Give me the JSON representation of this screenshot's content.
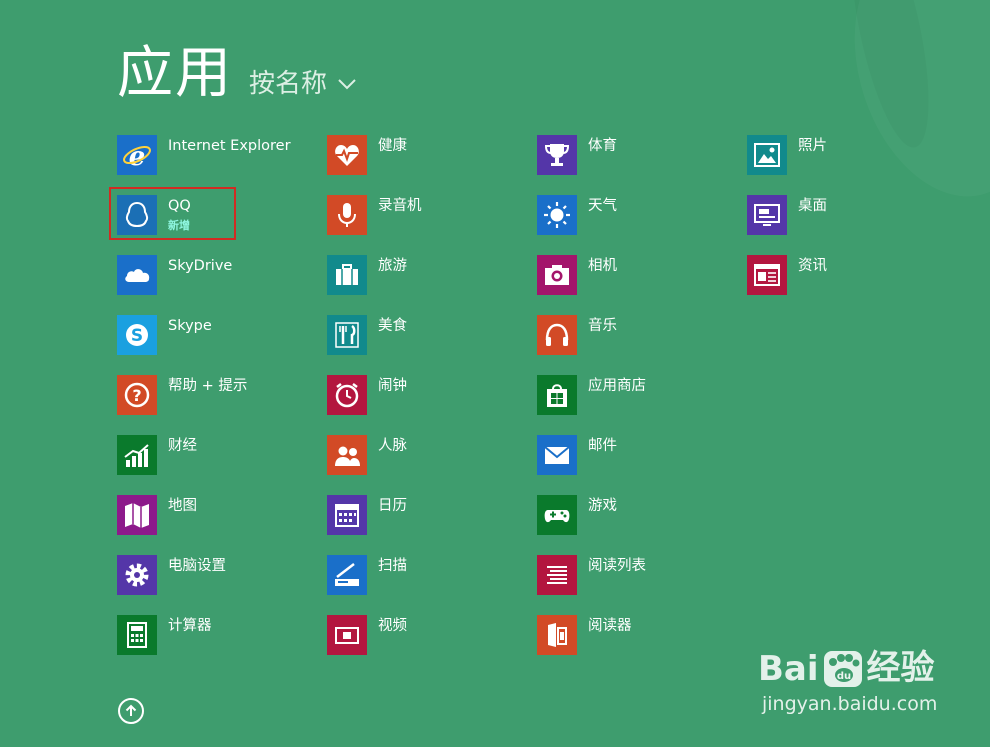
{
  "header": {
    "title": "应用",
    "sort_label": "按名称",
    "sort_icon": "chevron-down-icon"
  },
  "columns": [
    {
      "apps": [
        {
          "name": "Internet Explorer",
          "icon": "internet-explorer-icon",
          "color": "#1a6fc9"
        },
        {
          "name": "QQ",
          "icon": "qq-penguin-icon",
          "color": "#1b6fb5",
          "badge": "新增",
          "selected": true
        },
        {
          "name": "SkyDrive",
          "icon": "cloud-icon",
          "color": "#1a6fc9"
        },
        {
          "name": "Skype",
          "icon": "skype-icon",
          "color": "#1aa0e0"
        },
        {
          "name": "帮助 + 提示",
          "icon": "question-icon",
          "color": "#d24a26"
        },
        {
          "name": "财经",
          "icon": "finance-chart-icon",
          "color": "#0a7a2c"
        },
        {
          "name": "地图",
          "icon": "map-icon",
          "color": "#8d1a8b"
        },
        {
          "name": "电脑设置",
          "icon": "gear-icon",
          "color": "#5436a8"
        },
        {
          "name": "计算器",
          "icon": "calculator-icon",
          "color": "#0a7a2c"
        }
      ]
    },
    {
      "apps": [
        {
          "name": "健康",
          "icon": "heart-pulse-icon",
          "color": "#d24a26"
        },
        {
          "name": "录音机",
          "icon": "microphone-icon",
          "color": "#d24a26"
        },
        {
          "name": "旅游",
          "icon": "suitcase-icon",
          "color": "#118a8c"
        },
        {
          "name": "美食",
          "icon": "fork-knife-icon",
          "color": "#118a8c"
        },
        {
          "name": "闹钟",
          "icon": "alarm-clock-icon",
          "color": "#b3163f"
        },
        {
          "name": "人脉",
          "icon": "people-icon",
          "color": "#d24a26"
        },
        {
          "name": "日历",
          "icon": "calendar-icon",
          "color": "#5436a8"
        },
        {
          "name": "扫描",
          "icon": "scanner-icon",
          "color": "#1a6fc9"
        },
        {
          "name": "视频",
          "icon": "video-icon",
          "color": "#b3163f"
        }
      ]
    },
    {
      "apps": [
        {
          "name": "体育",
          "icon": "trophy-icon",
          "color": "#5436a8"
        },
        {
          "name": "天气",
          "icon": "sun-icon",
          "color": "#1a6fc9"
        },
        {
          "name": "相机",
          "icon": "camera-icon",
          "color": "#a3156b"
        },
        {
          "name": "音乐",
          "icon": "headphones-icon",
          "color": "#d24a26"
        },
        {
          "name": "应用商店",
          "icon": "store-bag-icon",
          "color": "#0a7a2c"
        },
        {
          "name": "邮件",
          "icon": "mail-icon",
          "color": "#1a6fc9"
        },
        {
          "name": "游戏",
          "icon": "gamepad-icon",
          "color": "#0a7a2c"
        },
        {
          "name": "阅读列表",
          "icon": "reading-list-icon",
          "color": "#b3163f"
        },
        {
          "name": "阅读器",
          "icon": "reader-icon",
          "color": "#d24a26"
        }
      ]
    },
    {
      "apps": [
        {
          "name": "照片",
          "icon": "photo-icon",
          "color": "#118a8c"
        },
        {
          "name": "桌面",
          "icon": "desktop-icon",
          "color": "#5436a8"
        },
        {
          "name": "资讯",
          "icon": "news-icon",
          "color": "#b3163f"
        }
      ]
    }
  ],
  "up_button_icon": "arrow-up-icon",
  "watermark": {
    "logo_text_1": "Bai",
    "logo_text_2": "经验",
    "url": "jingyan.baidu.com"
  },
  "colors": {
    "background": "#3e9d6e",
    "selection_outline": "#d12b22",
    "badge": "#8ff6e0"
  }
}
